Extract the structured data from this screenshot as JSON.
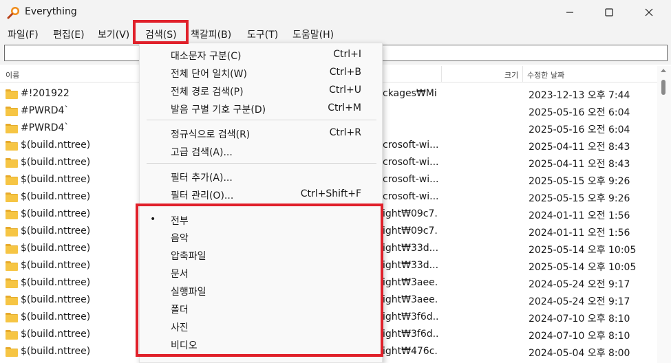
{
  "window": {
    "title": "Everything",
    "colors": {
      "highlight": "#e0202a",
      "folder": "#f6c544"
    }
  },
  "menubar": [
    {
      "label": "파일(F)"
    },
    {
      "label": "편집(E)"
    },
    {
      "label": "보기(V)"
    },
    {
      "label": "검색(S)"
    },
    {
      "label": "책갈피(B)"
    },
    {
      "label": "도구(T)"
    },
    {
      "label": "도움말(H)"
    }
  ],
  "search": {
    "value": "",
    "placeholder": ""
  },
  "columns": {
    "name": "이름",
    "size": "크기",
    "date": "수정한 날짜"
  },
  "rows": [
    {
      "name": "#!201922",
      "path": "ckages₩Mi...",
      "date": "2023-12-13 오후 7:44"
    },
    {
      "name": "#PWRD4`",
      "path": "",
      "date": "2025-05-16 오전 6:04"
    },
    {
      "name": "#PWRD4`",
      "path": "",
      "date": "2025-05-16 오전 6:04"
    },
    {
      "name": "$(build.nttree)",
      "path": "crosoft-wi...",
      "date": "2025-04-11 오전 8:43"
    },
    {
      "name": "$(build.nttree)",
      "path": "crosoft-wi...",
      "date": "2025-04-11 오전 8:43"
    },
    {
      "name": "$(build.nttree)",
      "path": "crosoft-wi...",
      "date": "2025-05-15 오후 9:26"
    },
    {
      "name": "$(build.nttree)",
      "path": "crosoft-wi...",
      "date": "2025-05-15 오후 9:26"
    },
    {
      "name": "$(build.nttree)",
      "path": "ight₩09c7...",
      "date": "2024-01-11 오전 1:56"
    },
    {
      "name": "$(build.nttree)",
      "path": "ight₩09c7...",
      "date": "2024-01-11 오전 1:56"
    },
    {
      "name": "$(build.nttree)",
      "path": "ight₩33d...",
      "date": "2025-05-14 오후 10:05"
    },
    {
      "name": "$(build.nttree)",
      "path": "ight₩33d...",
      "date": "2025-05-14 오후 10:05"
    },
    {
      "name": "$(build.nttree)",
      "path": "ight₩3aee...",
      "date": "2024-05-24 오전 9:17"
    },
    {
      "name": "$(build.nttree)",
      "path": "ight₩3aee...",
      "date": "2024-05-24 오전 9:17"
    },
    {
      "name": "$(build.nttree)",
      "path": "ight₩3f6d...",
      "date": "2024-07-10 오후 8:10"
    },
    {
      "name": "$(build.nttree)",
      "path": "ight₩3f6d...",
      "date": "2024-07-10 오후 8:10"
    },
    {
      "name": "$(build.nttree)",
      "path": "ight₩476c...",
      "date": "2024-05-04 오후 8:00"
    }
  ],
  "search_menu": {
    "items": [
      {
        "label": "대소문자 구분(C)",
        "shortcut": "Ctrl+I"
      },
      {
        "label": "전체 단어 일치(W)",
        "shortcut": "Ctrl+B"
      },
      {
        "label": "전체 경로 검색(P)",
        "shortcut": "Ctrl+U"
      },
      {
        "label": "발음 구별 기호 구분(D)",
        "shortcut": "Ctrl+M"
      },
      {
        "label": "정규식으로 검색(R)",
        "shortcut": "Ctrl+R"
      },
      {
        "label": "고급 검색(A)...",
        "shortcut": ""
      },
      {
        "label": "필터 추가(A)...",
        "shortcut": ""
      },
      {
        "label": "필터 관리(O)...",
        "shortcut": "Ctrl+Shift+F"
      }
    ],
    "filters": [
      {
        "label": "전부",
        "selected": true,
        "bullet": "•"
      },
      {
        "label": "음악"
      },
      {
        "label": "압축파일"
      },
      {
        "label": "문서"
      },
      {
        "label": "실행파일"
      },
      {
        "label": "폴더"
      },
      {
        "label": "사진"
      },
      {
        "label": "비디오"
      }
    ]
  }
}
